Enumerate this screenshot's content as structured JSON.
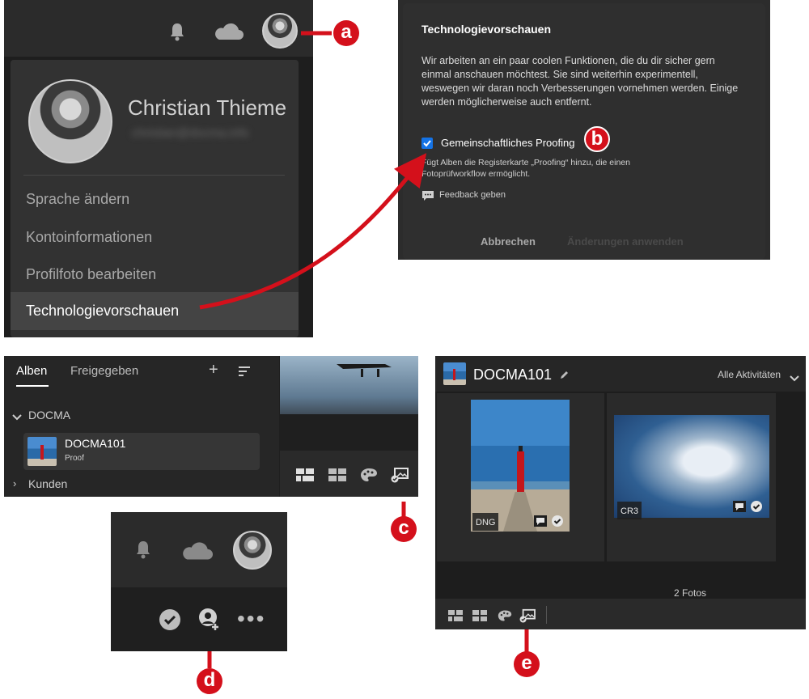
{
  "labels": {
    "a": "a",
    "b": "b",
    "c": "c",
    "d": "d",
    "e": "e"
  },
  "profile_menu": {
    "name": "Christian Thieme",
    "email_blurred": "christian@docma.info",
    "items": [
      "Sprache ändern",
      "Kontoinformationen",
      "Profilfoto bearbeiten",
      "Technologievorschauen"
    ]
  },
  "tech_dialog": {
    "title": "Technologievorschauen",
    "body": "Wir arbeiten an ein paar coolen Funktionen, die du dir sicher gern einmal anschauen möchtest. Sie sind weiterhin experimentell, weswegen wir daran noch Verbesserungen vornehmen werden. Einige werden möglicherweise auch entfernt.",
    "body_lines": [
      "Wir arbeiten an ein paar coolen Funktionen, die du dir sicher gern",
      "einmal anschauen möchtest. Sie sind weiterhin experimentell,",
      "weswegen wir daran noch Verbesserungen vornehmen werden. Einige",
      "werden möglicherweise auch entfernt."
    ],
    "checkbox_label": "Gemeinschaftliches Proofing",
    "checkbox_checked": true,
    "desc_lines": [
      "Fügt Alben die Registerkarte „Proofing“ hinzu, die einen",
      "Fotoprüfworkflow ermöglicht."
    ],
    "feedback": "Feedback geben",
    "cancel": "Abbrechen",
    "apply": "Änderungen anwenden"
  },
  "albums_panel": {
    "tabs": [
      "Alben",
      "Freigegeben"
    ],
    "group": "DOCMA",
    "album_name": "DOCMA101",
    "album_sub": "Proof",
    "next_group": "Kunden"
  },
  "album_view": {
    "title": "DOCMA101",
    "filter": "Alle Aktivitäten",
    "photos": [
      {
        "format": "DNG"
      },
      {
        "format": "CR3"
      }
    ],
    "count": "2 Fotos"
  },
  "icons": [
    "bell-icon",
    "cloud-icon",
    "avatar",
    "check-circle-icon",
    "add-person-icon",
    "more-icon",
    "pencil-icon",
    "chevron-down-icon",
    "plus-icon",
    "sort-icon",
    "grid-view-icon",
    "square-grid-icon",
    "palette-icon",
    "proof-icon",
    "comment-icon",
    "feedback-icon"
  ],
  "colors": {
    "accent_red": "#d4101b",
    "checkbox_blue": "#1473e6",
    "panel_bg": "#1f1f1f"
  }
}
